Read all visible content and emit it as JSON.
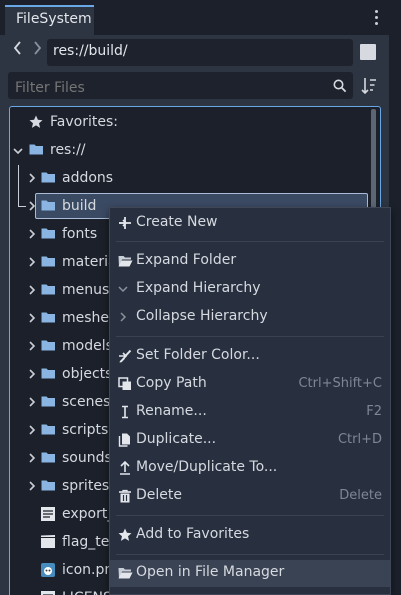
{
  "dock": {
    "tab_label": "FileSystem"
  },
  "toolbar": {
    "path": "res://build/",
    "filter_placeholder": "Filter Files"
  },
  "tree": {
    "favorites_label": "Favorites:",
    "root_label": "res://",
    "items": [
      {
        "label": "addons"
      },
      {
        "label": "build"
      },
      {
        "label": "fonts"
      },
      {
        "label": "materials"
      },
      {
        "label": "menus"
      },
      {
        "label": "meshes"
      },
      {
        "label": "models"
      },
      {
        "label": "objects"
      },
      {
        "label": "scenes"
      },
      {
        "label": "scripts"
      },
      {
        "label": "sounds"
      },
      {
        "label": "sprites"
      },
      {
        "label": "export_presets.cfg"
      },
      {
        "label": "flag_test.tscn"
      },
      {
        "label": "icon.png"
      },
      {
        "label": "LICENSE.md"
      }
    ]
  },
  "context_menu": {
    "items": [
      {
        "label": "Create New",
        "shortcut": ""
      },
      {
        "label": "Expand Folder",
        "shortcut": ""
      },
      {
        "label": "Expand Hierarchy",
        "shortcut": ""
      },
      {
        "label": "Collapse Hierarchy",
        "shortcut": ""
      },
      {
        "label": "Set Folder Color...",
        "shortcut": ""
      },
      {
        "label": "Copy Path",
        "shortcut": "Ctrl+Shift+C"
      },
      {
        "label": "Rename...",
        "shortcut": "F2"
      },
      {
        "label": "Duplicate...",
        "shortcut": "Ctrl+D"
      },
      {
        "label": "Move/Duplicate To...",
        "shortcut": ""
      },
      {
        "label": "Delete",
        "shortcut": "Delete"
      },
      {
        "label": "Add to Favorites",
        "shortcut": ""
      },
      {
        "label": "Open in File Manager",
        "shortcut": ""
      }
    ]
  },
  "colors": {
    "accent": "#6aa7e6",
    "folder": "#8ab4e2",
    "panel": "#2d3442",
    "tree_bg": "#1b202a"
  },
  "icons": [
    "kebab-menu-icon",
    "back-icon",
    "forward-icon",
    "search-icon",
    "sort-icon",
    "star-icon",
    "folder-icon",
    "chevron-right-icon",
    "chevron-down-icon",
    "plus-icon",
    "brush-icon",
    "copy-icon",
    "rename-icon",
    "duplicate-icon",
    "move-icon",
    "trash-icon",
    "folder-open-icon"
  ]
}
